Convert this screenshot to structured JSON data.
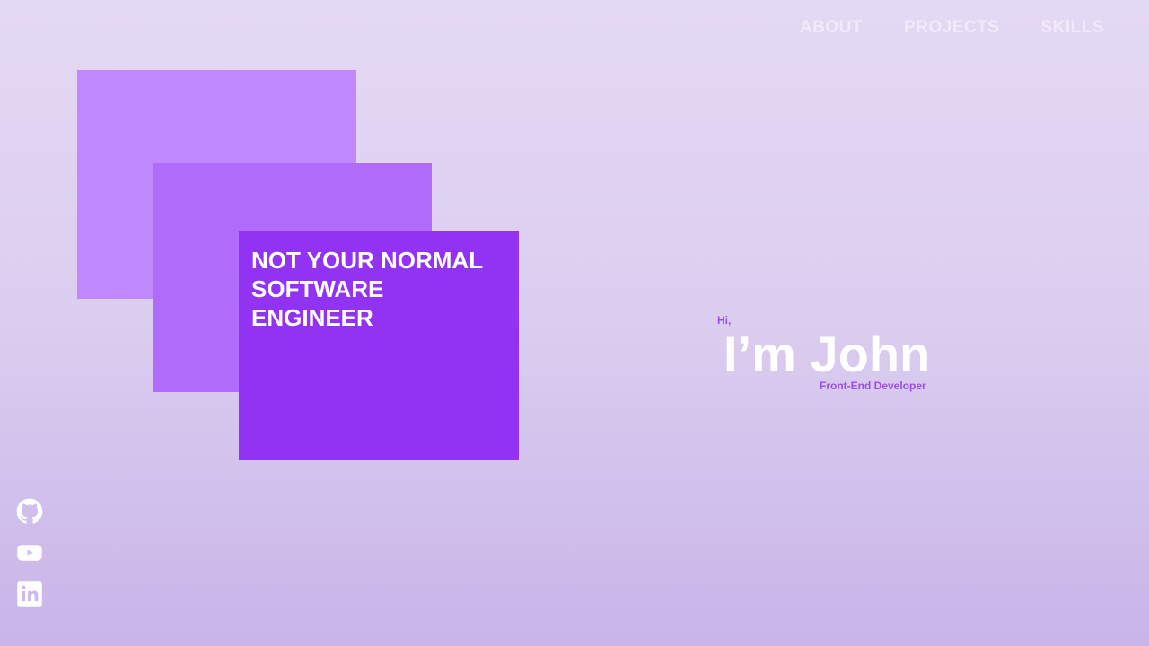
{
  "nav": {
    "items": [
      {
        "label": "ABOUT"
      },
      {
        "label": "PROJECTS"
      },
      {
        "label": "SKILLS"
      }
    ]
  },
  "cards": {
    "headline": "NOT YOUR NORMAL SOFTWARE ENGINEER"
  },
  "hero": {
    "greeting": "Hi,",
    "name": "I’m John",
    "role": "Front-End Developer"
  },
  "socials": [
    {
      "icon": "github-icon"
    },
    {
      "icon": "youtube-icon"
    },
    {
      "icon": "linkedin-icon"
    }
  ],
  "colors": {
    "card_back": "#c088fd",
    "card_middle": "#b06bfb",
    "card_front": "#9232f2",
    "accent_text": "#9b4de8"
  }
}
